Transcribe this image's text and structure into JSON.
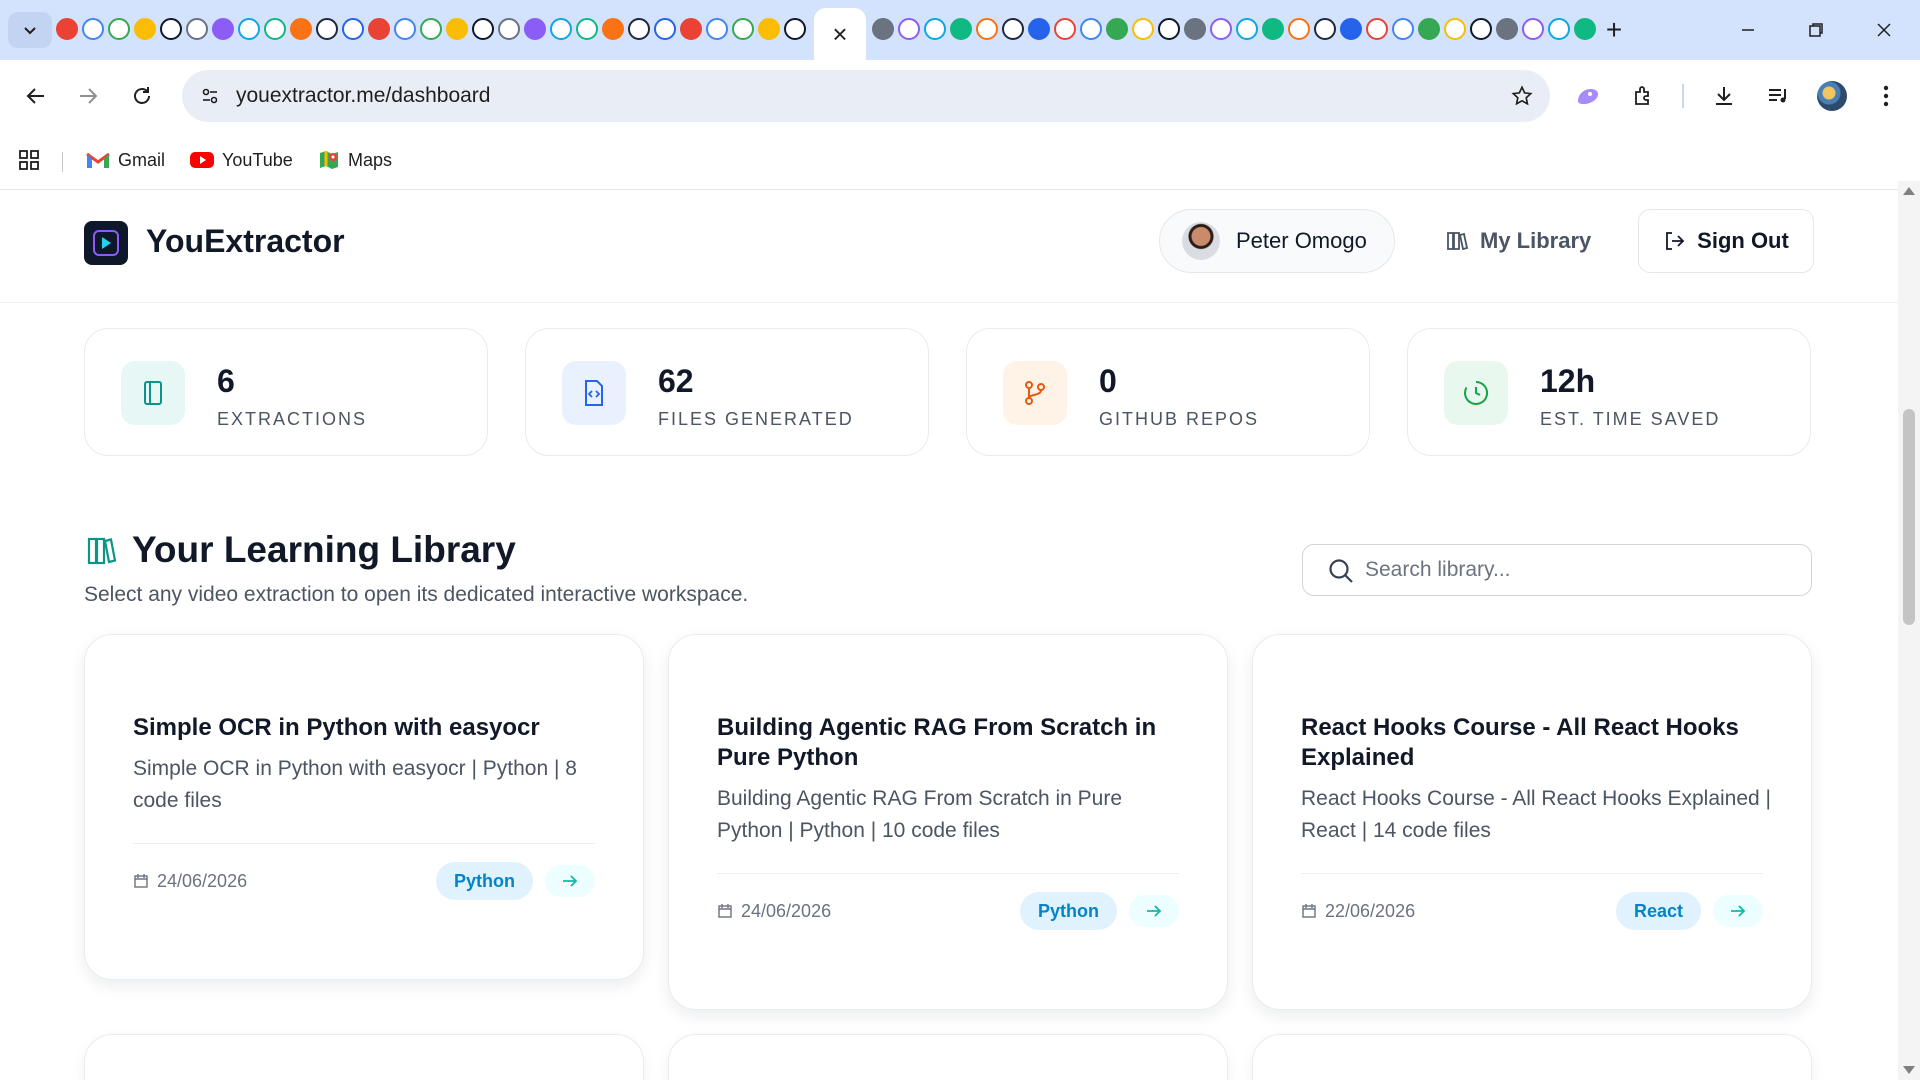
{
  "browser": {
    "active_tab_close": "×",
    "new_tab": "+",
    "address": "youextractor.me/dashboard",
    "bookmarks": [
      {
        "label": "Gmail"
      },
      {
        "label": "YouTube"
      },
      {
        "label": "Maps"
      }
    ]
  },
  "header": {
    "brand": "YouExtractor",
    "user_name": "Peter Omogo",
    "library_link": "My Library",
    "sign_out": "Sign Out"
  },
  "stats": [
    {
      "value": "6",
      "label": "EXTRACTIONS",
      "icon": "book-icon",
      "color": "#0d9488",
      "bg": "#e6f7f5"
    },
    {
      "value": "62",
      "label": "FILES GENERATED",
      "icon": "code-file-icon",
      "color": "#2563eb",
      "bg": "#e8f1fd"
    },
    {
      "value": "0",
      "label": "GITHUB REPOS",
      "icon": "git-branch-icon",
      "color": "#ea580c",
      "bg": "#fff3e8"
    },
    {
      "value": "12h",
      "label": "EST. TIME SAVED",
      "icon": "clock-icon",
      "color": "#16a34a",
      "bg": "#e8f8ee"
    }
  ],
  "library": {
    "title": "Your Learning Library",
    "subtitle": "Select any video extraction to open its dedicated interactive workspace.",
    "search_placeholder": "Search library..."
  },
  "cards": [
    {
      "title": "Simple OCR in Python with easyocr",
      "description": "Simple OCR in Python with easyocr | Python | 8 code files",
      "date": "24/06/2026",
      "tag": "Python"
    },
    {
      "title": "Building Agentic RAG From Scratch in Pure Python",
      "description": "Building Agentic RAG From Scratch in Pure Python | Python | 10 code files",
      "date": "24/06/2026",
      "tag": "Python"
    },
    {
      "title": "React Hooks Course - All React Hooks Explained",
      "description": "React Hooks Course - All React Hooks Explained | React | 14 code files",
      "date": "22/06/2026",
      "tag": "React"
    }
  ]
}
